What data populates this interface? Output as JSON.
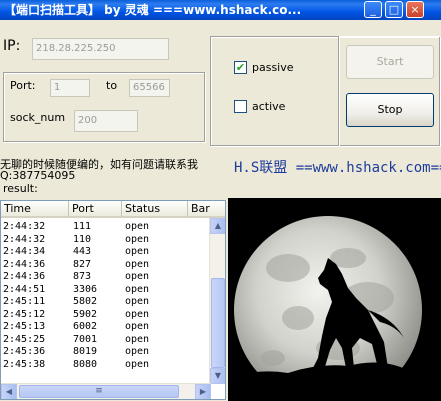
{
  "window": {
    "title": "【端口扫描工具】 by 灵魂 ===www.hshack.co...",
    "minimize_glyph": "_",
    "maximize_glyph": "□",
    "close_glyph": "×"
  },
  "ip": {
    "label": "IP:",
    "value": "218.28.225.250"
  },
  "port": {
    "label": "Port:",
    "start": "1",
    "to_label": "to",
    "end": "65566"
  },
  "sock": {
    "label": "sock_num",
    "value": "200"
  },
  "mode": {
    "passive_label": "passive",
    "passive_checked": true,
    "check_glyph": "✔",
    "active_label": "active",
    "active_checked": false
  },
  "buttons": {
    "start": "Start",
    "stop": "Stop"
  },
  "info": {
    "line1": "无聊的时候随便编的，如有问题请联系我",
    "line2": "Q:387754095",
    "result": "result:"
  },
  "banner": "H.S联盟 ==www.hshack.com==",
  "table": {
    "columns": [
      "Time",
      "Port",
      "Status",
      "Bar"
    ],
    "rows": [
      [
        "2:44:32",
        "111",
        "open"
      ],
      [
        "2:44:32",
        "110",
        "open"
      ],
      [
        "2:44:34",
        "443",
        "open"
      ],
      [
        "2:44:36",
        "827",
        "open"
      ],
      [
        "2:44:36",
        "873",
        "open"
      ],
      [
        "2:44:51",
        "3306",
        "open"
      ],
      [
        "2:45:11",
        "5802",
        "open"
      ],
      [
        "2:45:12",
        "5902",
        "open"
      ],
      [
        "2:45:13",
        "6002",
        "open"
      ],
      [
        "2:45:25",
        "7001",
        "open"
      ],
      [
        "2:45:36",
        "8019",
        "open"
      ],
      [
        "2:45:38",
        "8080",
        "open"
      ]
    ]
  },
  "scroll": {
    "up": "▲",
    "down": "▼",
    "left": "◀",
    "right": "▶",
    "grip": "≡"
  },
  "colors": {
    "titlebar": "#0055e5",
    "banner_text": "#1e3c9c",
    "window_bg": "#ece9d8"
  }
}
